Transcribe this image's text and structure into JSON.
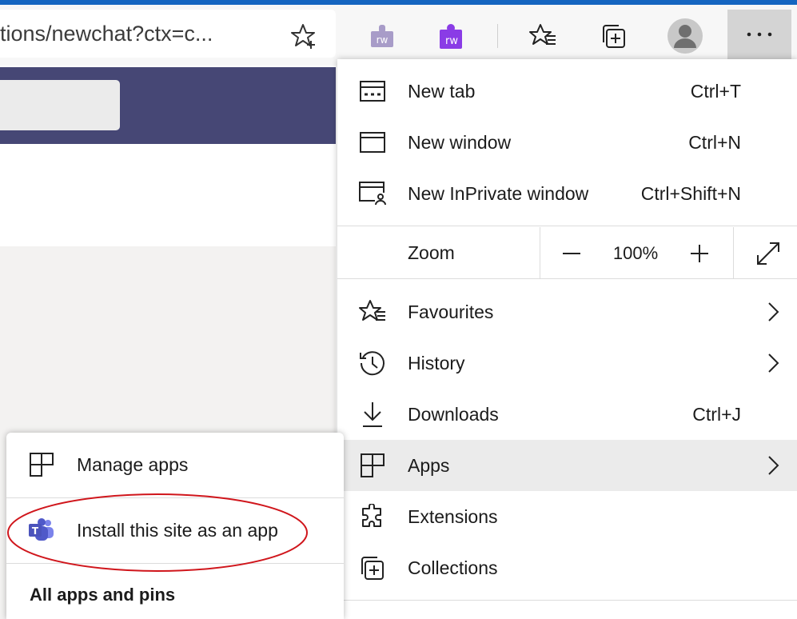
{
  "address_bar": {
    "url_text": "tions/newchat?ctx=c..."
  },
  "toolbar": {
    "icons": [
      "add-to-favourites-icon",
      "rw-extension-icon",
      "rw-puzzle-extension-icon",
      "favourites-icon",
      "collections-icon",
      "profile-icon",
      "settings-and-more-icon"
    ]
  },
  "menu": {
    "items": [
      {
        "label": "New tab",
        "shortcut": "Ctrl+T"
      },
      {
        "label": "New window",
        "shortcut": "Ctrl+N"
      },
      {
        "label": "New InPrivate window",
        "shortcut": "Ctrl+Shift+N"
      }
    ],
    "zoom": {
      "label": "Zoom",
      "value": "100%"
    },
    "items2": [
      {
        "label": "Favourites"
      },
      {
        "label": "History"
      },
      {
        "label": "Downloads",
        "shortcut": "Ctrl+J"
      },
      {
        "label": "Apps"
      },
      {
        "label": "Extensions"
      },
      {
        "label": "Collections"
      }
    ]
  },
  "apps_submenu": {
    "manage_apps": "Manage apps",
    "install_site": "Install this site as an app",
    "all_apps_heading": "All apps and pins"
  },
  "colors": {
    "accent_blue": "#1565c0",
    "teams_header": "#464775",
    "highlight_ellipse": "#d0161c",
    "hover_bg": "#ebebeb"
  }
}
